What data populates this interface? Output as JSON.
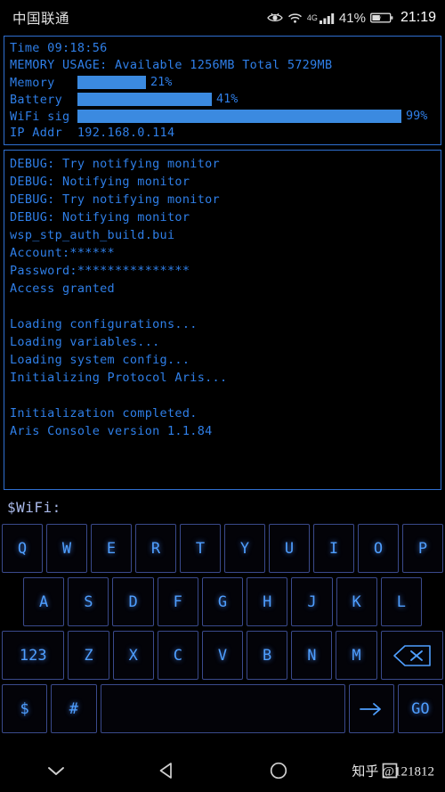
{
  "statusbar": {
    "carrier": "中国联通",
    "network_type": "4G",
    "battery_percent": "41%",
    "time": "21:19",
    "icons": [
      "eye-icon",
      "wifi-icon",
      "signal-bars-icon",
      "battery-icon"
    ]
  },
  "stats_panel": {
    "time_line": "Time 09:18:56",
    "memory_line": "MEMORY USAGE: Available 1256MB Total 5729MB",
    "bars": [
      {
        "label": "Memory",
        "percent": 21,
        "percent_text": "21%"
      },
      {
        "label": "Battery",
        "percent": 41,
        "percent_text": "41%"
      },
      {
        "label": "WiFi sig",
        "percent": 99,
        "percent_text": "99%"
      }
    ],
    "ip_label": "IP Addr",
    "ip_value": "192.168.0.114",
    "ip_line": "IP Addr  192.168.0.114"
  },
  "console": {
    "lines": [
      "DEBUG: Try notifying monitor",
      "DEBUG: Notifying monitor",
      "DEBUG: Try notifying monitor",
      "DEBUG: Notifying monitor",
      "wsp_stp_auth_build.bui",
      "Account:******",
      "Password:***************",
      "Access granted",
      "",
      "Loading configurations...",
      "Loading variables...",
      "Loading system config...",
      "Initializing Protocol Aris...",
      "",
      "Initialization completed.",
      "Aris Console version 1.1.84"
    ]
  },
  "prompt": {
    "text": "$WiFi:",
    "input_value": ""
  },
  "keyboard": {
    "row1": [
      "Q",
      "W",
      "E",
      "R",
      "T",
      "Y",
      "U",
      "I",
      "O",
      "P"
    ],
    "row2": [
      "A",
      "S",
      "D",
      "F",
      "G",
      "H",
      "J",
      "K",
      "L"
    ],
    "row3_numeric": "123",
    "row3": [
      "Z",
      "X",
      "C",
      "V",
      "B",
      "N",
      "M"
    ],
    "row3_backspace": "backspace-icon",
    "row4": {
      "dollar": "$",
      "hash": "#",
      "space": "",
      "arrow": "arrow-right-icon",
      "go": "GO"
    }
  },
  "navbar": {
    "buttons": [
      "chevron-down-icon",
      "back-icon",
      "home-icon",
      "recents-icon"
    ],
    "watermark": "知乎 @121812"
  },
  "colors": {
    "accent_blue": "#2f7fe8",
    "bar_fill": "#3b8ae0",
    "key_text": "#4f9fff",
    "panel_border": "#2f6fd0",
    "background": "#000000"
  }
}
